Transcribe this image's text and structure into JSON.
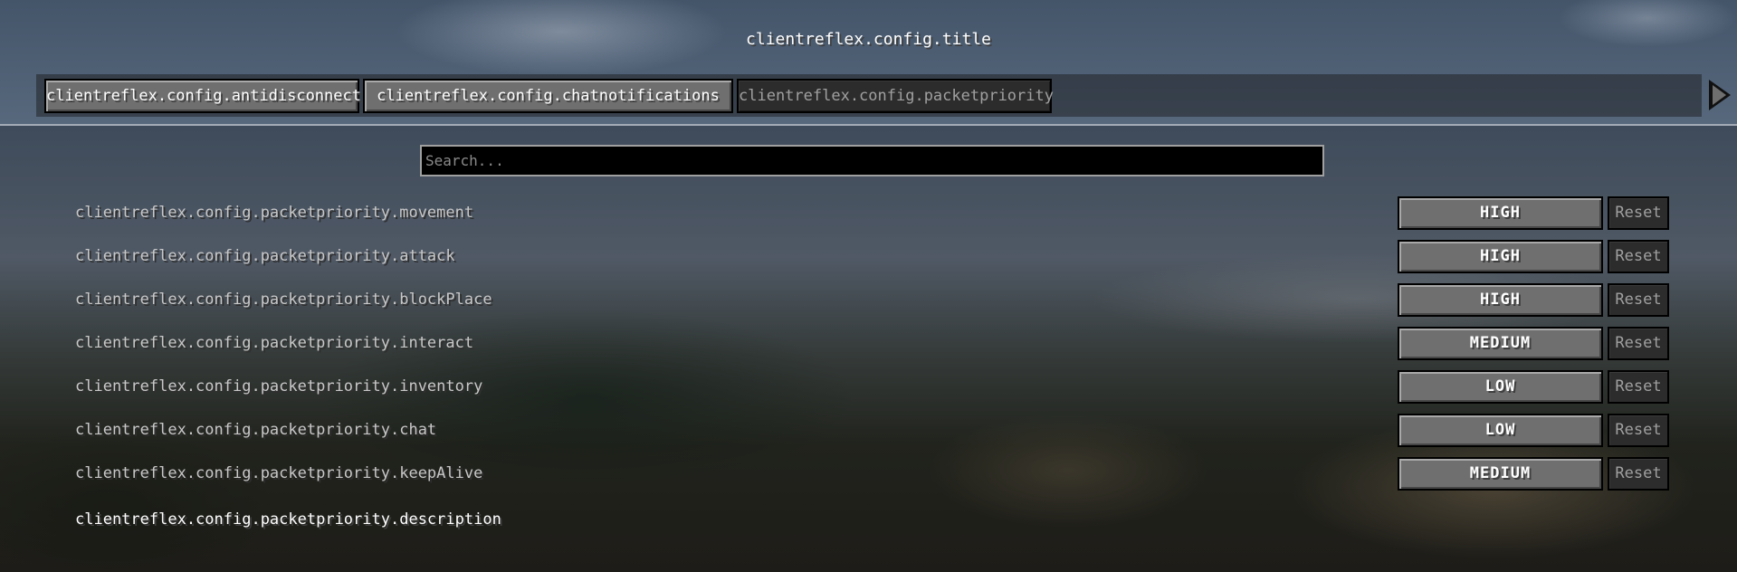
{
  "title": "clientreflex.config.title",
  "tabs": [
    {
      "label": "clientreflex.config.antidisconnect",
      "selected": false
    },
    {
      "label": "clientreflex.config.chatnotifications",
      "selected": false
    },
    {
      "label": "clientreflex.config.packetpriority",
      "selected": true
    }
  ],
  "tab_scroll_icon": "arrow-right-icon",
  "search": {
    "placeholder": "Search...",
    "value": ""
  },
  "entries": [
    {
      "label": "clientreflex.config.packetpriority.movement",
      "value": "HIGH",
      "reset_label": "Reset"
    },
    {
      "label": "clientreflex.config.packetpriority.attack",
      "value": "HIGH",
      "reset_label": "Reset"
    },
    {
      "label": "clientreflex.config.packetpriority.blockPlace",
      "value": "HIGH",
      "reset_label": "Reset"
    },
    {
      "label": "clientreflex.config.packetpriority.interact",
      "value": "MEDIUM",
      "reset_label": "Reset"
    },
    {
      "label": "clientreflex.config.packetpriority.inventory",
      "value": "LOW",
      "reset_label": "Reset"
    },
    {
      "label": "clientreflex.config.packetpriority.chat",
      "value": "LOW",
      "reset_label": "Reset"
    },
    {
      "label": "clientreflex.config.packetpriority.keepAlive",
      "value": "MEDIUM",
      "reset_label": "Reset"
    }
  ],
  "description": "clientreflex.config.packetpriority.description"
}
